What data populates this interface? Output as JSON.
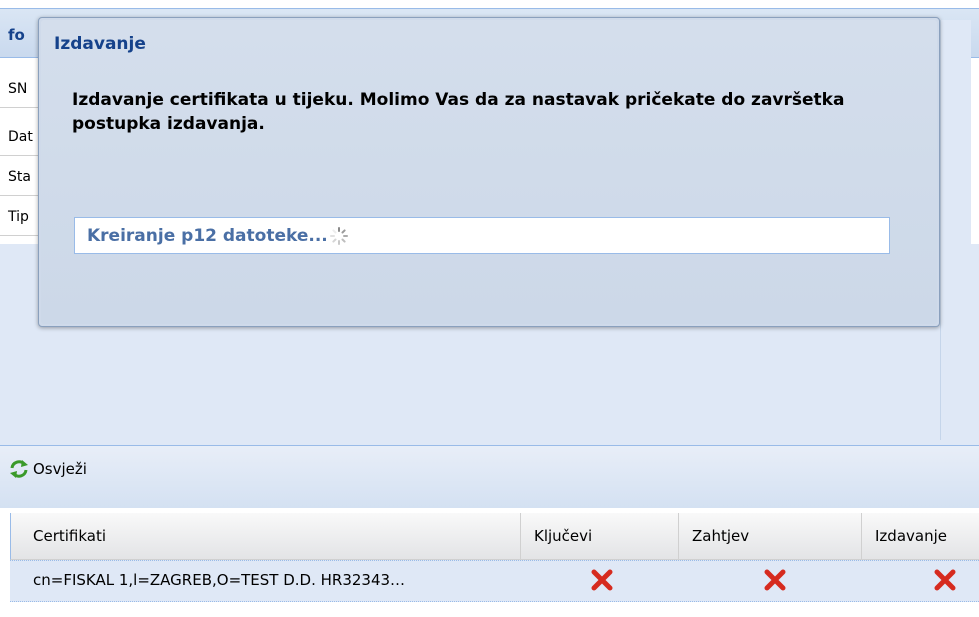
{
  "info_panel": {
    "title": "fo",
    "field_labels": [
      "SN",
      "Dat",
      "Sta",
      "Tip"
    ]
  },
  "toolbar": {
    "refresh_label": "Osvježi",
    "refresh_icon": "refresh-icon"
  },
  "grid": {
    "columns": [
      "Certifikati",
      "Ključevi",
      "Zahtjev",
      "Izdavanje"
    ],
    "rows": [
      {
        "certifikat": "cn=FISKAL 1,l=ZAGREB,O=TEST D.D. HR32343…",
        "kljucevi": "status-x-icon",
        "zahtjev": "status-x-icon",
        "izdavanje": "status-x-icon"
      }
    ],
    "status_color": "#d62b1f"
  },
  "dialog": {
    "title": "Izdavanje",
    "message": "Izdavanje certifikata u tijeku. Molimo Vas da za nastavak pričekate do završetka postupka izdavanja.",
    "progress_text": "Kreiranje p12 datoteke...",
    "progress_icon": "loading-spinner-icon"
  },
  "colors": {
    "title_blue": "#15428b",
    "panel_bg": "#dfe8f6",
    "border_blue": "#99bbe8"
  }
}
